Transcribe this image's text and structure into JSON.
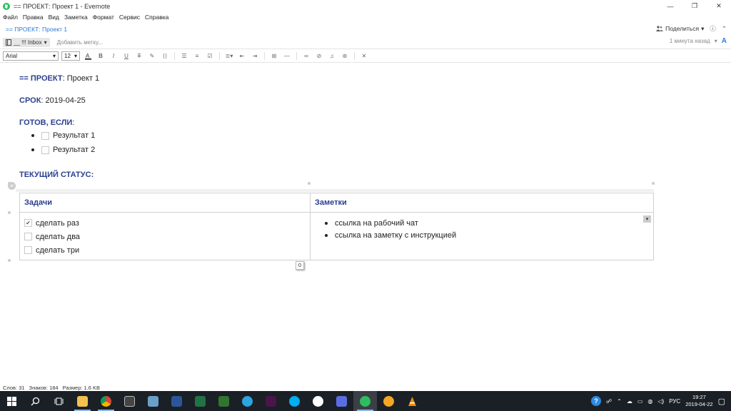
{
  "window": {
    "title": "== ПРОЕКТ: Проект 1 - Evernote",
    "minimize": "—",
    "maximize": "❐",
    "close": "✕"
  },
  "menu": [
    "Файл",
    "Правка",
    "Вид",
    "Заметка",
    "Формат",
    "Сервис",
    "Справка"
  ],
  "note_header": {
    "breadcrumb": "== ПРОЕКТ: Проект 1",
    "share_label": "Поделиться",
    "share_caret": "▾",
    "info_icon": "ⓘ",
    "collapse_icon": "⌃"
  },
  "tags": {
    "notebook": "__ !!! Inbox",
    "add_tag": "Добавить метку...",
    "updated": "1 минута назад",
    "updated_caret": "▾",
    "font_icon": "A"
  },
  "toolbar": {
    "font": "Arial",
    "size": "12",
    "caret": "▾"
  },
  "note": {
    "line1_label": "== ПРОЕКТ",
    "line1_value": ": Проект 1",
    "line2_label": "СРОК",
    "line2_value": ": 2019-04-25",
    "line3_label": "ГОТОВ, ЕСЛИ",
    "line3_value": ":",
    "results": [
      "Результат 1",
      "Результат 2"
    ],
    "status_label": "ТЕКУЩИЙ СТАТУС:",
    "table": {
      "headers": [
        "Задачи",
        "Заметки"
      ],
      "tasks": [
        {
          "text": "сделать раз",
          "checked": true
        },
        {
          "text": "сделать два",
          "checked": false
        },
        {
          "text": "сделать три",
          "checked": false
        }
      ],
      "notes": [
        "ссылка на рабочий чат",
        "ссылка на заметку с инструкцией"
      ],
      "count_badge": "0"
    }
  },
  "status": {
    "words": "Слов: 31",
    "chars": "Знаков: 184",
    "size": "Размер: 1.6 KB"
  },
  "taskbar": {
    "lang": "РУС",
    "time": "19:27",
    "date": "2019-04-22"
  }
}
